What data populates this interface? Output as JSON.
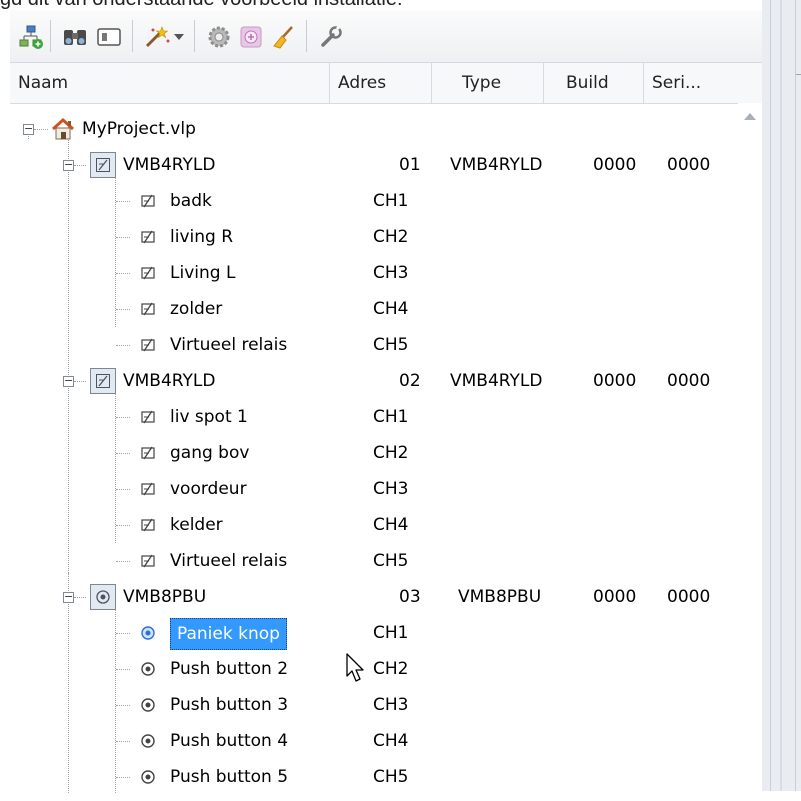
{
  "page_text": "gd dit van onderstaande voorbeeld installatie:",
  "toolbar": {
    "buttons": [
      {
        "icon": "add-module-icon"
      },
      {
        "icon": "binoculars-icon"
      },
      {
        "icon": "window-icon"
      },
      {
        "icon": "magic-wand-icon"
      },
      {
        "icon": "dropdown-arrow-icon"
      },
      {
        "icon": "gear-icon"
      },
      {
        "icon": "plus-box-icon"
      },
      {
        "icon": "broom-icon"
      },
      {
        "icon": "wrench-icon"
      }
    ]
  },
  "columns": [
    "Naam",
    "Adres",
    "Type",
    "Build",
    "Seri..."
  ],
  "project": {
    "name": "MyProject.vlp",
    "expander": "−"
  },
  "modules": [
    {
      "name": "VMB4RYLD",
      "adres": "01",
      "type": "VMB4RYLD",
      "build": "0000",
      "serial": "0000",
      "icon": "relay-module-icon",
      "expander": "−",
      "channels": [
        {
          "name": "badk",
          "ch": "CH1",
          "icon": "relay-icon"
        },
        {
          "name": "living R",
          "ch": "CH2",
          "icon": "relay-icon"
        },
        {
          "name": "Living L",
          "ch": "CH3",
          "icon": "relay-icon"
        },
        {
          "name": "zolder",
          "ch": "CH4",
          "icon": "relay-icon"
        },
        {
          "name": "Virtueel relais",
          "ch": "CH5",
          "icon": "relay-icon"
        }
      ]
    },
    {
      "name": "VMB4RYLD",
      "adres": "02",
      "type": "VMB4RYLD",
      "build": "0000",
      "serial": "0000",
      "icon": "relay-module-icon",
      "expander": "−",
      "channels": [
        {
          "name": "liv spot 1",
          "ch": "CH1",
          "icon": "relay-icon"
        },
        {
          "name": "gang bov",
          "ch": "CH2",
          "icon": "relay-icon"
        },
        {
          "name": "voordeur",
          "ch": "CH3",
          "icon": "relay-icon"
        },
        {
          "name": "kelder",
          "ch": "CH4",
          "icon": "relay-icon"
        },
        {
          "name": "Virtueel relais",
          "ch": "CH5",
          "icon": "relay-icon"
        }
      ]
    },
    {
      "name": "VMB8PBU",
      "adres": "03",
      "type": "VMB8PBU",
      "build": "0000",
      "serial": "0000",
      "icon": "pushbutton-module-icon",
      "expander": "−",
      "channels": [
        {
          "name": "Paniek knop",
          "ch": "CH1",
          "icon": "push-button-icon",
          "selected": true
        },
        {
          "name": "Push button 2",
          "ch": "CH2",
          "icon": "push-button-icon"
        },
        {
          "name": "Push button 3",
          "ch": "CH3",
          "icon": "push-button-icon"
        },
        {
          "name": "Push button 4",
          "ch": "CH4",
          "icon": "push-button-icon"
        },
        {
          "name": "Push button 5",
          "ch": "CH5",
          "icon": "push-button-icon"
        }
      ]
    }
  ],
  "colors": {
    "selection": "#3399ff",
    "header_bg": "#f7f8fa",
    "toolbar_bg": "#eef0f3"
  }
}
